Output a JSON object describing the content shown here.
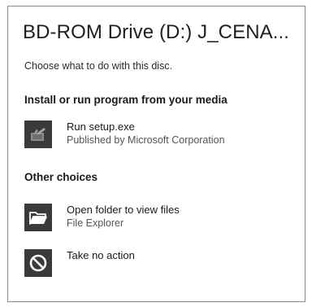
{
  "dialog": {
    "title": "BD-ROM Drive (D:) J_CENA...",
    "prompt": "Choose what to do with this disc."
  },
  "sections": [
    {
      "heading": "Install or run program from your media",
      "options": [
        {
          "title": "Run setup.exe",
          "subtitle": "Published by Microsoft Corporation",
          "icon": "setup-program-icon"
        }
      ]
    },
    {
      "heading": "Other choices",
      "options": [
        {
          "title": "Open folder to view files",
          "subtitle": "File Explorer",
          "icon": "folder-icon"
        },
        {
          "title": "Take no action",
          "subtitle": "",
          "icon": "no-action-icon"
        }
      ]
    }
  ],
  "colors": {
    "tile_background": "#3a3a3a",
    "icon_foreground": "#ffffff",
    "border": "#8a8a8a"
  }
}
